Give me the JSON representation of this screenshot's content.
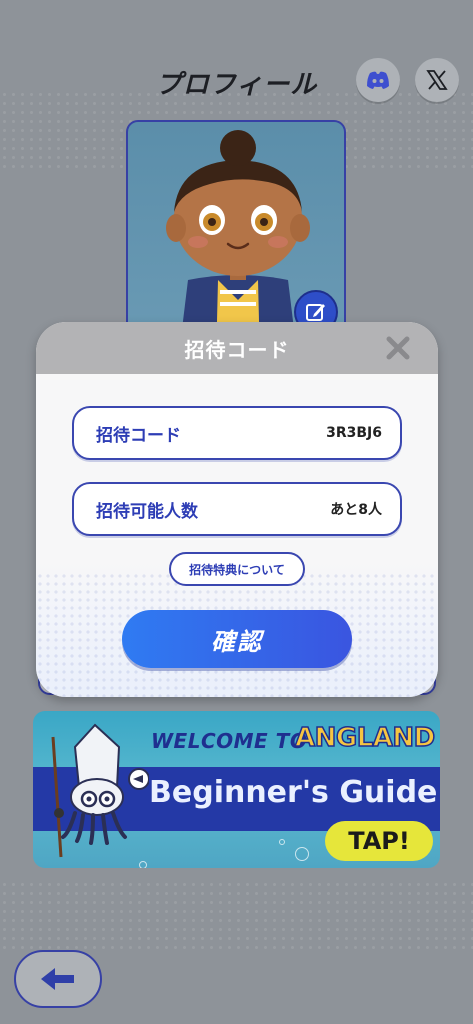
{
  "page": {
    "title": "プロフィール"
  },
  "social": {
    "discord_icon": "discord-icon",
    "x_icon": "x-logo-icon"
  },
  "avatar": {
    "edit_icon": "edit-pencil-icon"
  },
  "modal": {
    "title": "招待コード",
    "close_icon": "close-x-icon",
    "fields": [
      {
        "label": "招待コード",
        "value": "3R3BJ6"
      },
      {
        "label": "招待可能人数",
        "value": "あと8人"
      }
    ],
    "about_label": "招待特典について",
    "confirm_label": "確認"
  },
  "banner": {
    "welcome": "WELCOME TO",
    "brand": "ANGLAND",
    "guide": "Beginner's Guide",
    "tap": "TAP!"
  },
  "nav": {
    "back_icon": "arrow-left-icon"
  },
  "colors": {
    "background": "#8e9399",
    "accent_blue": "#3a47b0",
    "confirm_gradient_start": "#2f7bf2",
    "confirm_gradient_end": "#3a55e0"
  }
}
